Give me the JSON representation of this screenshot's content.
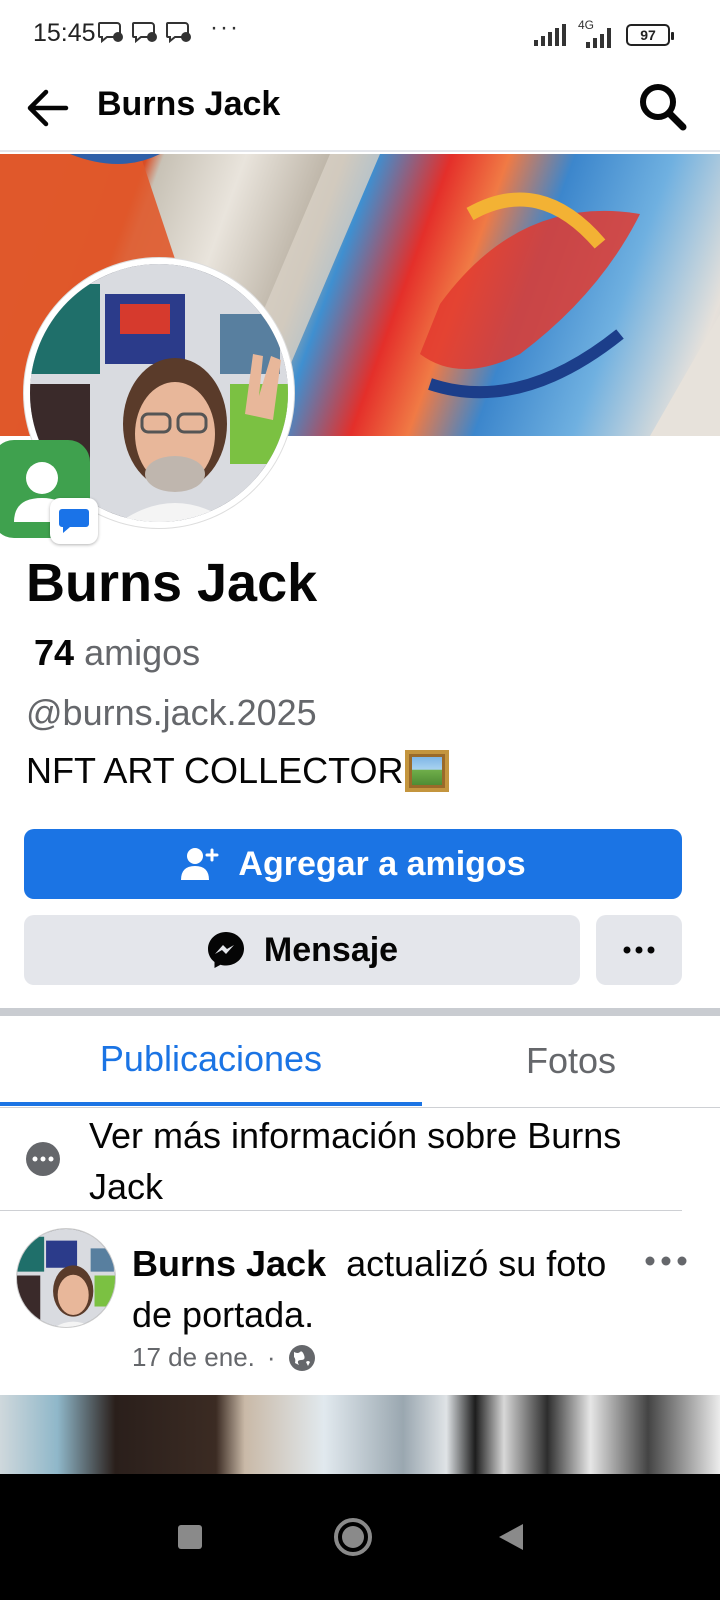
{
  "status_bar": {
    "time": "15:45",
    "overflow": "···",
    "network": "4G",
    "battery": "97"
  },
  "header": {
    "title": "Burns Jack"
  },
  "profile": {
    "name": "Burns Jack",
    "friends_count": "74",
    "friends_label": "amigos",
    "handle": "@burns.jack.2025",
    "bio": "NFT ART COLLECTOR"
  },
  "actions": {
    "add_friend_label": "Agregar a amigos",
    "message_label": "Mensaje"
  },
  "tabs": [
    {
      "label": "Publicaciones",
      "active": true
    },
    {
      "label": "Fotos",
      "active": false
    }
  ],
  "info_row": {
    "label": "Ver más información sobre Burns Jack"
  },
  "post": {
    "author": "Burns Jack",
    "action_text": "actualizó su foto de portada.",
    "date": "17 de ene.",
    "separator": "·"
  },
  "colors": {
    "accent": "#1b74e4",
    "secondary_button": "#e4e6eb",
    "muted_text": "#65676b"
  }
}
